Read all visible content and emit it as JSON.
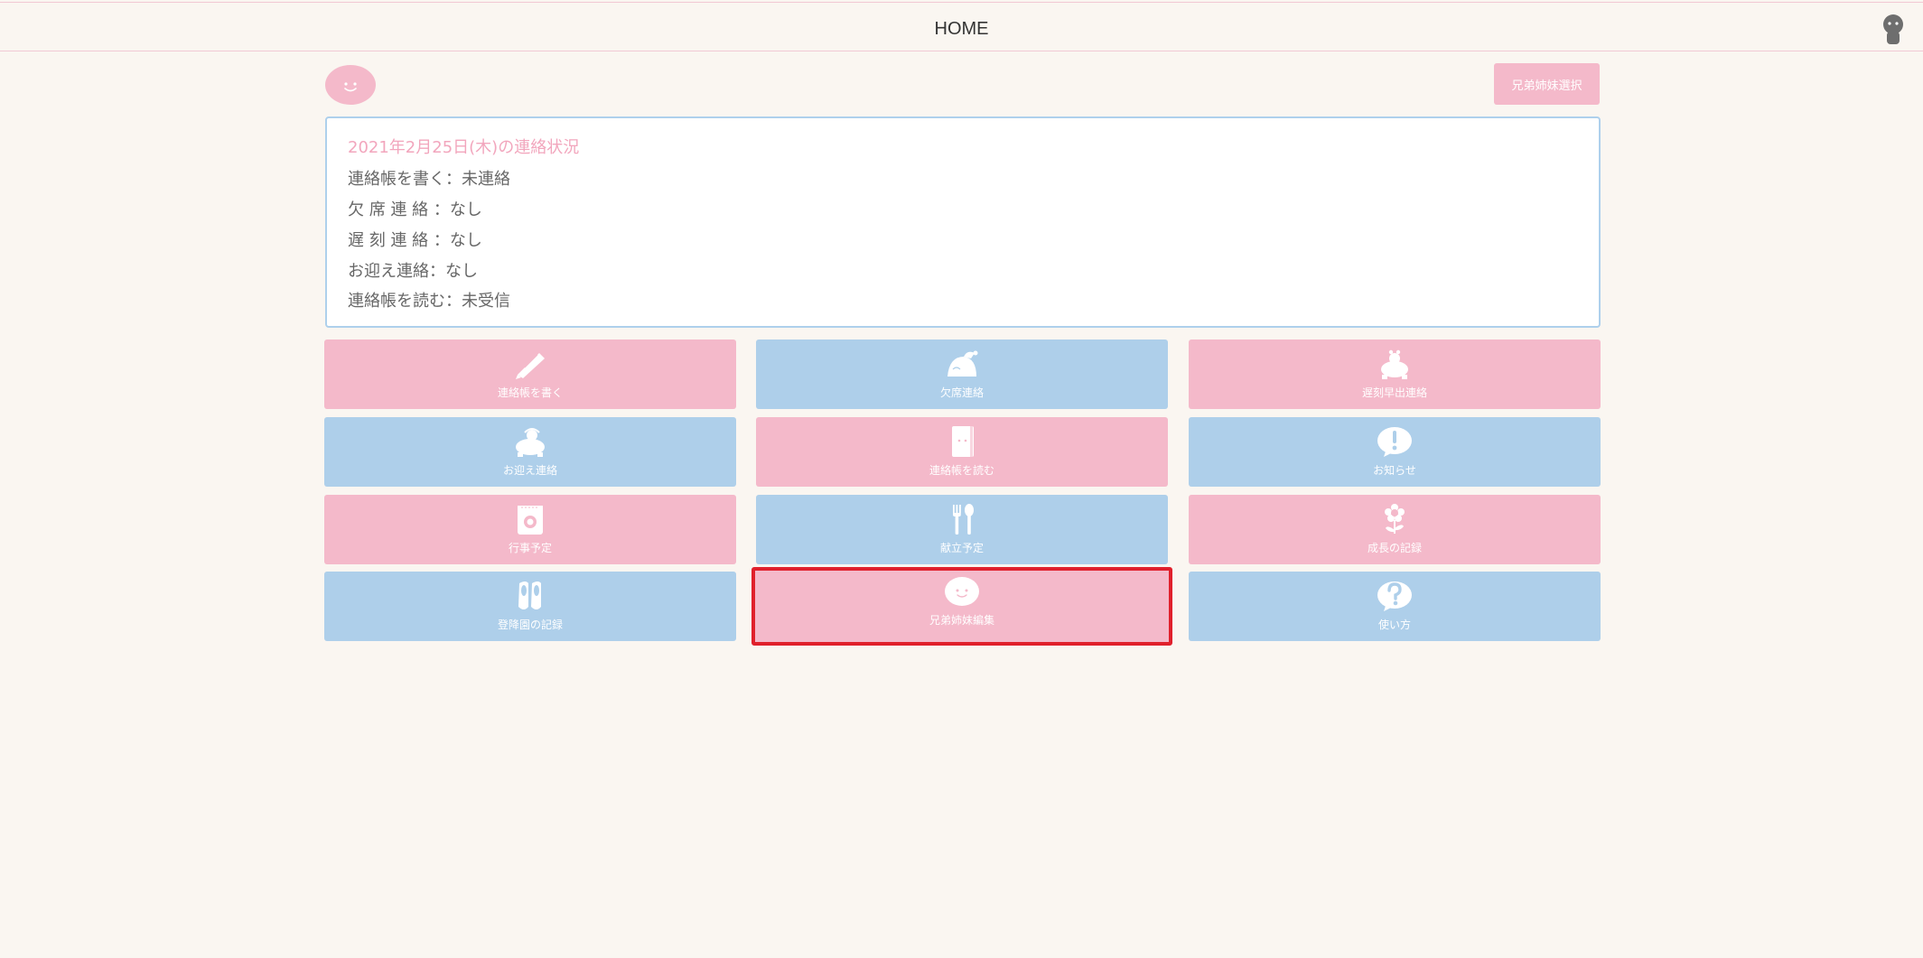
{
  "header": {
    "title": "HOME"
  },
  "top": {
    "sibling_select_label": "兄弟姉妹選択"
  },
  "status": {
    "heading": "2021年2月25日(木)の連絡状況",
    "lines": [
      "連絡帳を書く：未連絡",
      "欠 席 連 絡 ：なし",
      "遅 刻 連 絡 ：なし",
      "お迎え連絡：なし",
      "連絡帳を読む：未受信"
    ]
  },
  "tiles": [
    {
      "label": "連絡帳を書く",
      "color": "pink",
      "icon": "pencil-icon"
    },
    {
      "label": "欠席連絡",
      "color": "blue",
      "icon": "sleeping-turtle-icon"
    },
    {
      "label": "遅刻早出連絡",
      "color": "pink",
      "icon": "turtle-icon"
    },
    {
      "label": "お迎え連絡",
      "color": "blue",
      "icon": "turtle-icon"
    },
    {
      "label": "連絡帳を読む",
      "color": "pink",
      "icon": "notebook-icon"
    },
    {
      "label": "お知らせ",
      "color": "blue",
      "icon": "exclamation-icon"
    },
    {
      "label": "行事予定",
      "color": "pink",
      "icon": "calendar-icon"
    },
    {
      "label": "献立予定",
      "color": "blue",
      "icon": "fork-spoon-icon"
    },
    {
      "label": "成長の記録",
      "color": "pink",
      "icon": "flower-icon"
    },
    {
      "label": "登降園の記録",
      "color": "blue",
      "icon": "shoes-icon"
    },
    {
      "label": "兄弟姉妹編集",
      "color": "pink",
      "icon": "smiley-face-icon",
      "selected": true
    },
    {
      "label": "使い方",
      "color": "blue",
      "icon": "question-icon"
    }
  ],
  "colors": {
    "pink": "#f4b9ca",
    "blue": "#aecfea",
    "background": "#faf6f1",
    "highlight": "#e0202c",
    "card_border": "#aed0ec"
  }
}
